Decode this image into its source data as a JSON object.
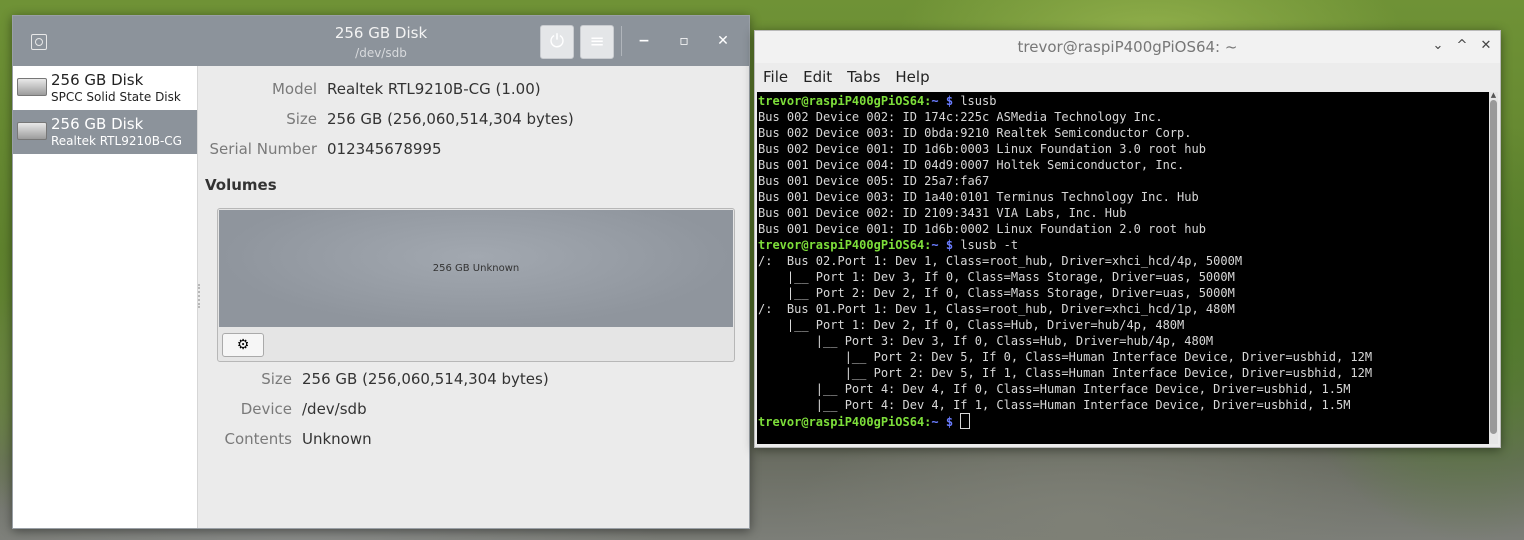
{
  "disks": {
    "title": "256 GB Disk",
    "subtitle": "/dev/sdb",
    "power_icon": "⏻",
    "menu_icon": "≡",
    "minimize_icon": "−",
    "maximize_icon": "▫",
    "close_icon": "✕",
    "drives": [
      {
        "name": "256 GB Disk",
        "desc": "SPCC Solid State Disk"
      },
      {
        "name": "256 GB Disk",
        "desc": "Realtek RTL9210B-CG"
      }
    ],
    "info": {
      "model_label": "Model",
      "model_value": "Realtek RTL9210B-CG (1.00)",
      "size_label": "Size",
      "size_value": "256 GB (256,060,514,304 bytes)",
      "serial_label": "Serial Number",
      "serial_value": "012345678995"
    },
    "volumes_heading": "Volumes",
    "partition_label": "256 GB Unknown",
    "gear_icon": "⚙",
    "volume_info": {
      "size_label": "Size",
      "size_value": "256 GB (256,060,514,304 bytes)",
      "device_label": "Device",
      "device_value": "/dev/sdb",
      "contents_label": "Contents",
      "contents_value": "Unknown"
    }
  },
  "terminal": {
    "title": "trevor@raspiP400gPiOS64: ~",
    "chevron_down_icon": "⌄",
    "chevron_up_icon": "^",
    "close_icon": "✕",
    "menu": [
      "File",
      "Edit",
      "Tabs",
      "Help"
    ],
    "prompt_user": "trevor@raspiP400gPiOS64",
    "prompt_sep": ":",
    "prompt_path": "~ $",
    "commands": [
      "lsusb",
      "lsusb -t"
    ],
    "lsusb_output": [
      "Bus 002 Device 002: ID 174c:225c ASMedia Technology Inc.",
      "Bus 002 Device 003: ID 0bda:9210 Realtek Semiconductor Corp.",
      "Bus 002 Device 001: ID 1d6b:0003 Linux Foundation 3.0 root hub",
      "Bus 001 Device 004: ID 04d9:0007 Holtek Semiconductor, Inc.",
      "Bus 001 Device 005: ID 25a7:fa67",
      "Bus 001 Device 003: ID 1a40:0101 Terminus Technology Inc. Hub",
      "Bus 001 Device 002: ID 2109:3431 VIA Labs, Inc. Hub",
      "Bus 001 Device 001: ID 1d6b:0002 Linux Foundation 2.0 root hub"
    ],
    "tree_output": [
      "/:  Bus 02.Port 1: Dev 1, Class=root_hub, Driver=xhci_hcd/4p, 5000M",
      "    |__ Port 1: Dev 3, If 0, Class=Mass Storage, Driver=uas, 5000M",
      "    |__ Port 2: Dev 2, If 0, Class=Mass Storage, Driver=uas, 5000M",
      "/:  Bus 01.Port 1: Dev 1, Class=root_hub, Driver=xhci_hcd/1p, 480M",
      "    |__ Port 1: Dev 2, If 0, Class=Hub, Driver=hub/4p, 480M",
      "        |__ Port 3: Dev 3, If 0, Class=Hub, Driver=hub/4p, 480M",
      "            |__ Port 2: Dev 5, If 0, Class=Human Interface Device, Driver=usbhid, 12M",
      "            |__ Port 2: Dev 5, If 1, Class=Human Interface Device, Driver=usbhid, 12M",
      "        |__ Port 4: Dev 4, If 0, Class=Human Interface Device, Driver=usbhid, 1.5M",
      "        |__ Port 4: Dev 4, If 1, Class=Human Interface Device, Driver=usbhid, 1.5M"
    ]
  }
}
